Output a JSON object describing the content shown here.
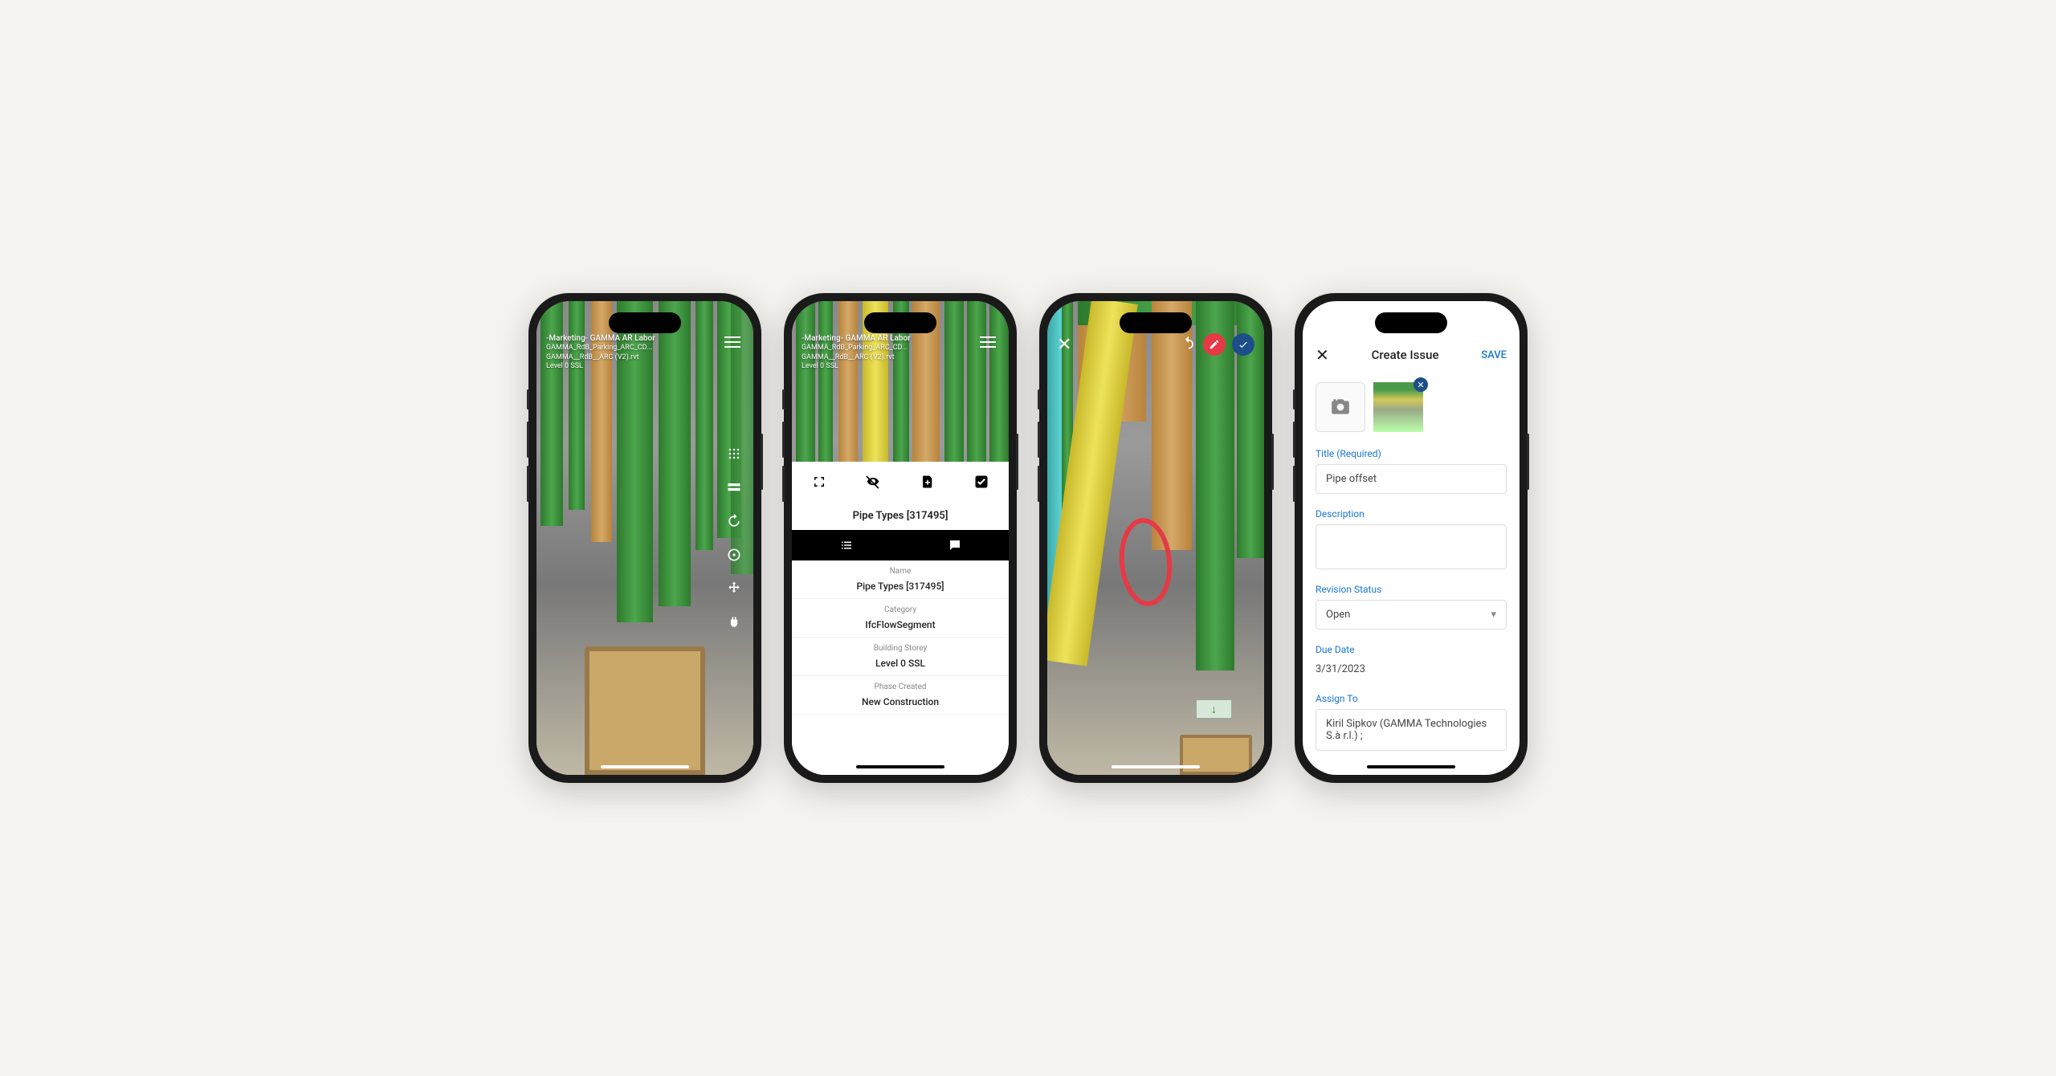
{
  "phone1": {
    "project_title": "-Marketing- GAMMA AR Labor",
    "model_line1": "GAMMA_RdB_Parking_ARC_CD...",
    "model_line2": "GAMMA__RdB__ARC (V2).rvt",
    "level": "Level 0 SSL"
  },
  "phone2": {
    "project_title": "-Marketing- GAMMA AR Labor",
    "model_line1": "GAMMA_RdB_Parking_ARC_CD...",
    "model_line2": "GAMMA__RdB__ARC (V2).rvt",
    "level": "Level 0 SSL",
    "panel_title": "Pipe Types [317495]",
    "props": [
      {
        "label": "Name",
        "value": "Pipe Types [317495]"
      },
      {
        "label": "Category",
        "value": "IfcFlowSegment"
      },
      {
        "label": "Building Storey",
        "value": "Level 0 SSL"
      },
      {
        "label": "Phase Created",
        "value": "New Construction"
      }
    ]
  },
  "phone4": {
    "header_title": "Create Issue",
    "save_label": "SAVE",
    "title_label": "Title (Required)",
    "title_value": "Pipe offset",
    "description_label": "Description",
    "revision_label": "Revision Status",
    "revision_value": "Open",
    "due_label": "Due Date",
    "due_value": "3/31/2023",
    "assign_label": "Assign To",
    "assign_value": "Kiril Sipkov (GAMMA Technologies S.à r.l.) ;"
  }
}
